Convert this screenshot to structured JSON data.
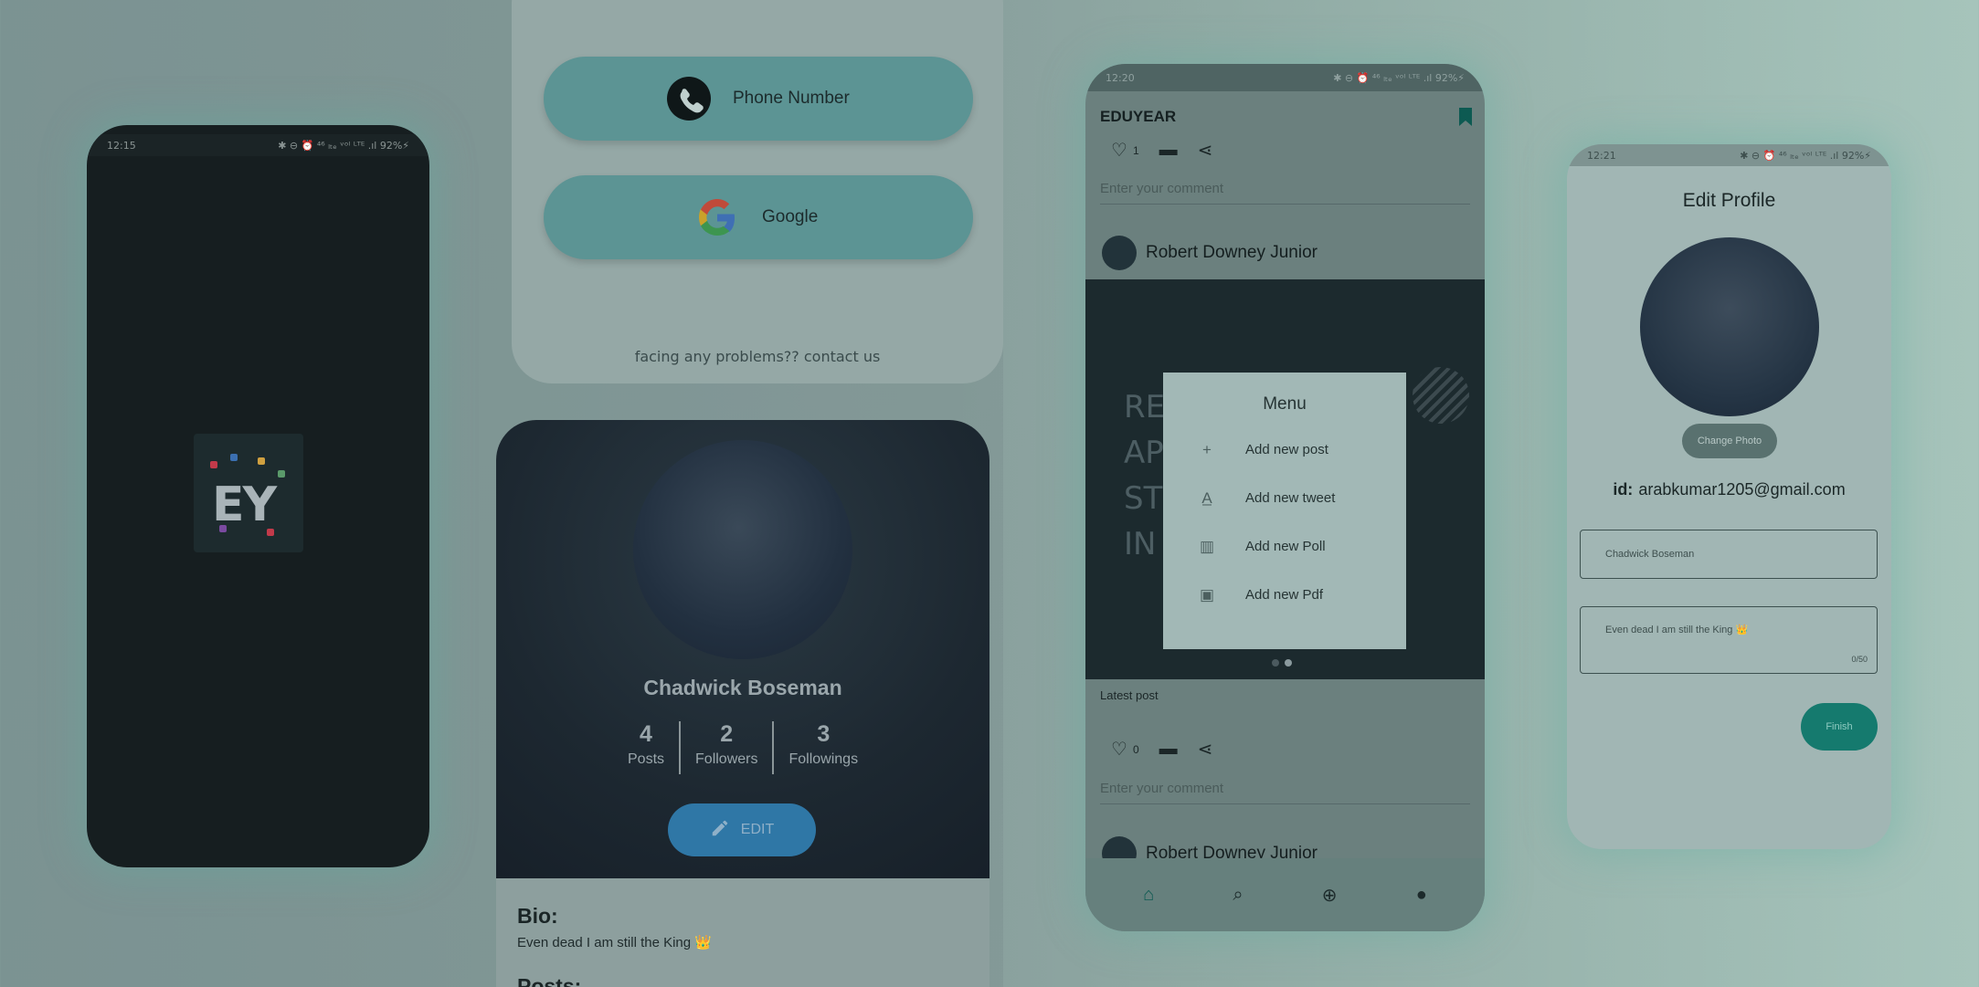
{
  "splash": {
    "status_time": "12:15",
    "status_icons": "✱ ⊖ ⏰ ⁴⁶ ₗₜₑ ᵛᵒˡ ᴸᵀᴱ .ıl 92%⚡",
    "logo_text": "EY"
  },
  "login": {
    "phone_label": "Phone Number",
    "google_label": "Google",
    "contact_text": "facing any problems?? contact us"
  },
  "profile": {
    "name": "Chadwick Boseman",
    "stats": [
      {
        "value": "4",
        "label": "Posts"
      },
      {
        "value": "2",
        "label": "Followers"
      },
      {
        "value": "3",
        "label": "Followings"
      }
    ],
    "edit_label": "EDIT",
    "bio_heading": "Bio:",
    "bio_text": "Even dead I am still the King 👑",
    "posts_heading": "Posts:"
  },
  "feed": {
    "status_time": "12:20",
    "status_icons": "✱ ⊖ ⏰ ⁴⁶ ₗₜₑ ᵛᵒˡ ᴸᵀᴱ .ıl 92%⚡",
    "app_title": "EDUYEAR",
    "likes_1": "1",
    "comment_placeholder": "Enter your comment",
    "author_name": "Robert Downey Junior",
    "post_lines": [
      "RE",
      "AP",
      "ST",
      "IN"
    ],
    "menu": {
      "title": "Menu",
      "items": [
        {
          "icon": "plus-icon",
          "label": "Add new post"
        },
        {
          "icon": "tweet-icon",
          "label": "Add new tweet"
        },
        {
          "icon": "poll-icon",
          "label": "Add new Poll"
        },
        {
          "icon": "pdf-icon",
          "label": "Add new Pdf"
        }
      ]
    },
    "latest_label": "Latest post",
    "likes_2": "0"
  },
  "edit_profile": {
    "status_time": "12:21",
    "status_icons": "✱ ⊖ ⏰ ⁴⁶ ₗₜₑ ᵛᵒˡ ᴸᵀᴱ .ıl 92%⚡",
    "title": "Edit Profile",
    "change_photo": "Change Photo",
    "id_label": "id:",
    "id_value": "arabkumar1205@gmail.com",
    "name_value": "Chadwick Boseman",
    "bio_value": "Even dead I am still the King 👑",
    "bio_count": "0/50",
    "finish_label": "Finish"
  }
}
